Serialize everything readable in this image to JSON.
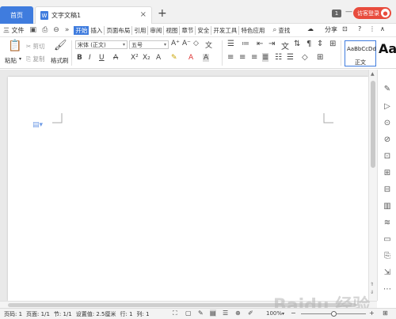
{
  "titlebar": {
    "home_tab": "首页",
    "doc_tab": "文字文稿1",
    "doc_icon": "W",
    "close": "×",
    "new_tab": "+",
    "badge": "1",
    "login": "访客登录",
    "window_controls": [
      "—",
      "□",
      "✕"
    ]
  },
  "menu": {
    "file": "三 文件",
    "tabs": [
      "开始",
      "插入",
      "页面布局",
      "引用",
      "审阅",
      "视图",
      "章节",
      "安全",
      "开发工具",
      "特色应用"
    ],
    "active_tab": "开始",
    "search": "查找",
    "share": "分享",
    "help": "?"
  },
  "ribbon": {
    "paste": "粘贴",
    "cut": "剪切",
    "copy": "复制",
    "format_painter": "格式刷",
    "font_name": "宋体 (正文)",
    "font_size": "五号",
    "style_sample": "AaBbCcDd",
    "style_name": "正文",
    "style_big": "Aa"
  },
  "status": {
    "page": "页码: 1",
    "pages": "页面: 1/1",
    "section": "节: 1/1",
    "setting": "设置值: 2.5厘米",
    "row": "行: 1",
    "col": "列: 1",
    "zoom": "100%"
  },
  "watermark": "Baidu 经验",
  "colors": {
    "accent": "#3f7cde",
    "login": "#e84c3d"
  }
}
